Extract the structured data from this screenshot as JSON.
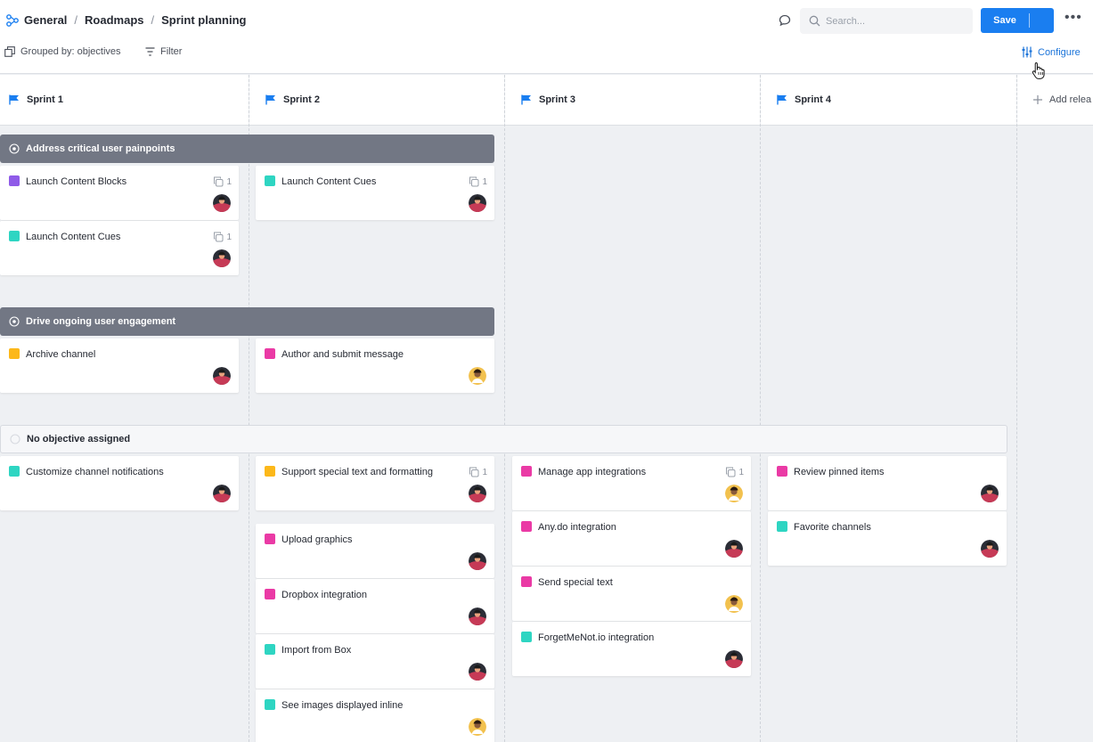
{
  "breadcrumb": [
    "General",
    "Roadmaps",
    "Sprint planning"
  ],
  "breadcrumb_sep": "/",
  "search": {
    "placeholder": "Search..."
  },
  "save_label": "Save",
  "toolbar": {
    "grouped": "Grouped by: objectives",
    "filter": "Filter",
    "configure": "Configure"
  },
  "columns": [
    "Sprint 1",
    "Sprint 2",
    "Sprint 3",
    "Sprint 4"
  ],
  "add_release": "Add relea",
  "groups": [
    {
      "label": "Address critical user painpoints"
    },
    {
      "label": "Drive ongoing user engagement"
    },
    {
      "label": "No objective assigned"
    }
  ],
  "colors": {
    "purple": "#8f5be8",
    "teal": "#2ed5c2",
    "yellow": "#fcb81a",
    "pink": "#ea3aa5",
    "accent": "#1a7ef0"
  },
  "cards": [
    {
      "title": "Launch Content Blocks",
      "color": "#8f5be8",
      "links": "1",
      "avatar": "dark"
    },
    {
      "title": "Launch Content Cues",
      "color": "#2ed5c2",
      "links": "1",
      "avatar": "dark"
    },
    {
      "title": "Launch Content Cues",
      "color": "#2ed5c2",
      "links": "1",
      "avatar": "dark"
    },
    {
      "title": "Archive channel",
      "color": "#fcb81a",
      "links": "",
      "avatar": "dark"
    },
    {
      "title": "Author and submit message",
      "color": "#ea3aa5",
      "links": "",
      "avatar": "yellow"
    },
    {
      "title": "Customize channel notifications",
      "color": "#2ed5c2",
      "links": "",
      "avatar": "dark"
    },
    {
      "title": "Support special text and formatting",
      "color": "#fcb81a",
      "links": "1",
      "avatar": "dark"
    },
    {
      "title": "Upload graphics",
      "color": "#ea3aa5",
      "links": "",
      "avatar": "dark"
    },
    {
      "title": "Dropbox integration",
      "color": "#ea3aa5",
      "links": "",
      "avatar": "dark"
    },
    {
      "title": "Import from Box",
      "color": "#2ed5c2",
      "links": "",
      "avatar": "dark"
    },
    {
      "title": "See images displayed inline",
      "color": "#2ed5c2",
      "links": "",
      "avatar": "yellow"
    },
    {
      "title": "Manage app integrations",
      "color": "#ea3aa5",
      "links": "1",
      "avatar": "yellow"
    },
    {
      "title": "Any.do integration",
      "color": "#ea3aa5",
      "links": "",
      "avatar": "dark"
    },
    {
      "title": "Send special text",
      "color": "#ea3aa5",
      "links": "",
      "avatar": "yellow"
    },
    {
      "title": "ForgetMeNot.io integration",
      "color": "#2ed5c2",
      "links": "",
      "avatar": "dark"
    },
    {
      "title": "Review pinned items",
      "color": "#ea3aa5",
      "links": "",
      "avatar": "dark"
    },
    {
      "title": "Favorite channels",
      "color": "#2ed5c2",
      "links": "",
      "avatar": "dark"
    }
  ]
}
